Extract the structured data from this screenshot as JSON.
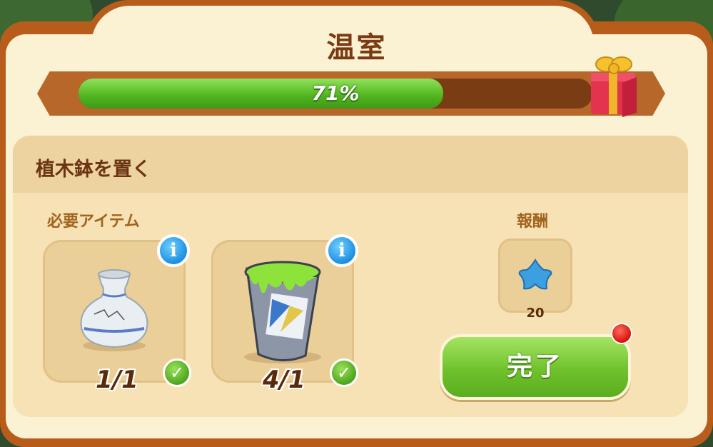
{
  "header": {
    "title": "温室"
  },
  "progress": {
    "percent": 71,
    "label": "71%"
  },
  "task": {
    "title": "植木鉢を置く"
  },
  "requirements": {
    "label": "必要アイテム",
    "items": [
      {
        "name": "vase",
        "count": "1/1",
        "info": "i",
        "check": "✓"
      },
      {
        "name": "paint-bucket",
        "count": "4/1",
        "info": "i",
        "check": "✓"
      }
    ]
  },
  "reward": {
    "label": "報酬",
    "icon": "blue-star-icon",
    "amount": "20"
  },
  "complete_button": {
    "label": "完了"
  },
  "colors": {
    "frame": "#b85c1c",
    "panel": "#fbf1d3",
    "progress_fill": "#4fb31e",
    "button": "#6fc22c",
    "notification": "#d6120c"
  }
}
